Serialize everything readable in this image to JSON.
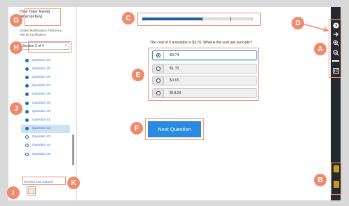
{
  "sidebar": {
    "test_taker_name": "[Test Taker Name]",
    "attempt_key": "[Attempt Key]",
    "exam_title_line1": "Ontario Mathematics Proficiency",
    "exam_title_line2": "Test for Certification",
    "section_selector": "Section 2 of 4",
    "questions": [
      {
        "label": "Question 34",
        "answered": true
      },
      {
        "label": "Question 35",
        "answered": true
      },
      {
        "label": "Question 36",
        "answered": true
      },
      {
        "label": "Question 37",
        "answered": true
      },
      {
        "label": "Question 38",
        "answered": true
      },
      {
        "label": "Question 39",
        "answered": true
      },
      {
        "label": "Question 40",
        "answered": true
      },
      {
        "label": "Question 41",
        "answered": true
      },
      {
        "label": "Question 42",
        "answered": true,
        "current": true
      },
      {
        "label": "Question 43",
        "answered": false
      },
      {
        "label": "Question 44",
        "answered": false
      },
      {
        "label": "Question 45",
        "answered": false
      }
    ],
    "review_link": "Review and Submit"
  },
  "main": {
    "question_text": "The cost of 5 avocados is $3.70. What is the cost per avocado?",
    "options": [
      "$0.74",
      "$1.35",
      "$3.65",
      "$18.50"
    ],
    "selected_option_index": 0,
    "next_button": "Next Question"
  },
  "toolbar": {
    "icons": [
      "help-icon",
      "arrow-right-icon",
      "zoom-in-icon",
      "zoom-out-icon",
      "line-reader-icon",
      "calculator-icon",
      "formula-sheet-icon",
      "ruler-icon"
    ]
  },
  "callouts": [
    "A",
    "B",
    "C",
    "D",
    "E",
    "F",
    "G",
    "H",
    "I",
    "J",
    "K"
  ],
  "colors": {
    "accent": "#2b8be0",
    "callout": "#f08a6d",
    "toolbar_bg": "#26292e",
    "progress_fill": "#1b5fa8"
  }
}
